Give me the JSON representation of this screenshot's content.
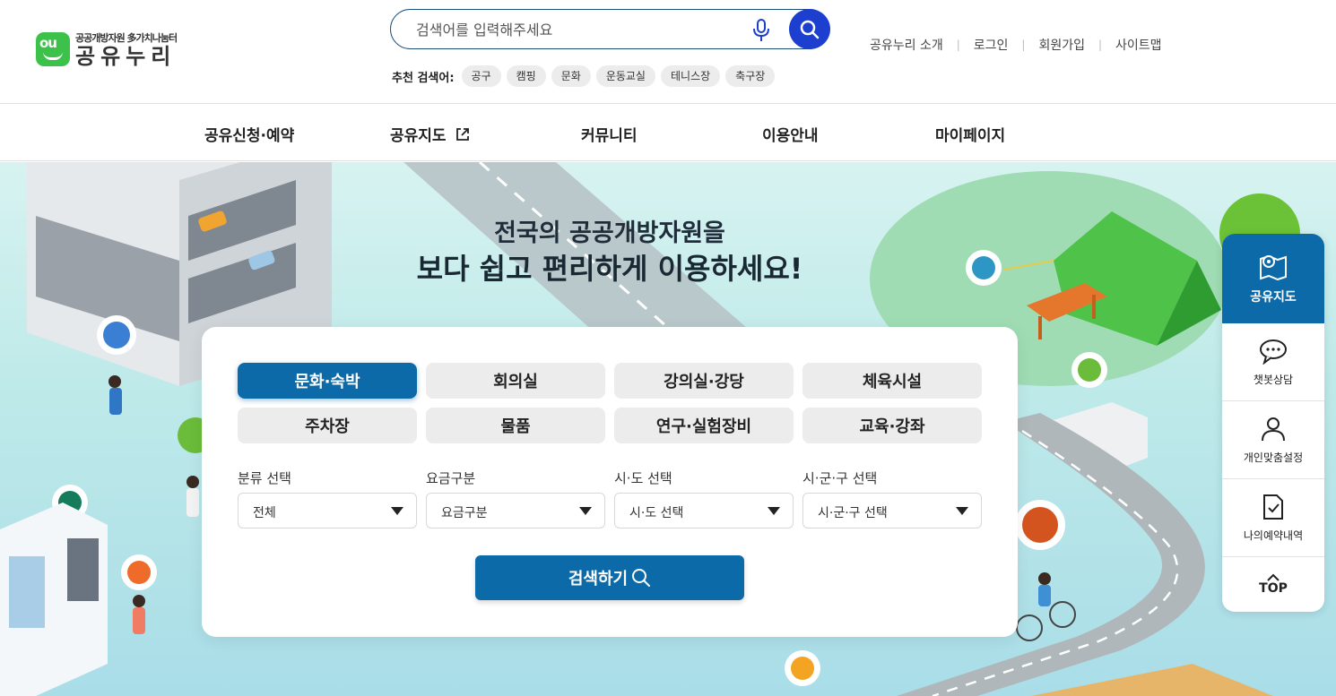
{
  "logo": {
    "sub": "공공개방자원 多가치나눔터",
    "main": "공유누리"
  },
  "search": {
    "placeholder": "검색어를 입력해주세요"
  },
  "recommend": {
    "label": "추천 검색어:",
    "keywords": [
      "공구",
      "캠핑",
      "문화",
      "운동교실",
      "테니스장",
      "축구장"
    ]
  },
  "util": [
    "공유누리 소개",
    "로그인",
    "회원가입",
    "사이트맵"
  ],
  "nav": [
    "공유신청·예약",
    "공유지도",
    "커뮤니티",
    "이용안내",
    "마이페이지"
  ],
  "hero": {
    "line1": "전국의 공공개방자원을",
    "line2": "보다 쉽고 편리하게 이용하세요!"
  },
  "categories": [
    "문화·숙박",
    "회의실",
    "강의실·강당",
    "체육시설",
    "주차장",
    "물품",
    "연구·실험장비",
    "교육·강좌"
  ],
  "active_category": "문화·숙박",
  "filters": [
    {
      "label": "분류 선택",
      "value": "전체"
    },
    {
      "label": "요금구분",
      "value": "요금구분"
    },
    {
      "label": "시·도 선택",
      "value": "시·도 선택"
    },
    {
      "label": "시·군·구 선택",
      "value": "시·군·구 선택"
    }
  ],
  "submit_label": "검색하기",
  "quick_menu": {
    "map": "공유지도",
    "chatbot": "챗봇상담",
    "custom": "개인맞춤설정",
    "reservations": "나의예약내역",
    "top": "TOP"
  },
  "colors": {
    "primary": "#0d6aa8",
    "search_button": "#1d3fcf",
    "brand_green": "#3cc24a"
  }
}
